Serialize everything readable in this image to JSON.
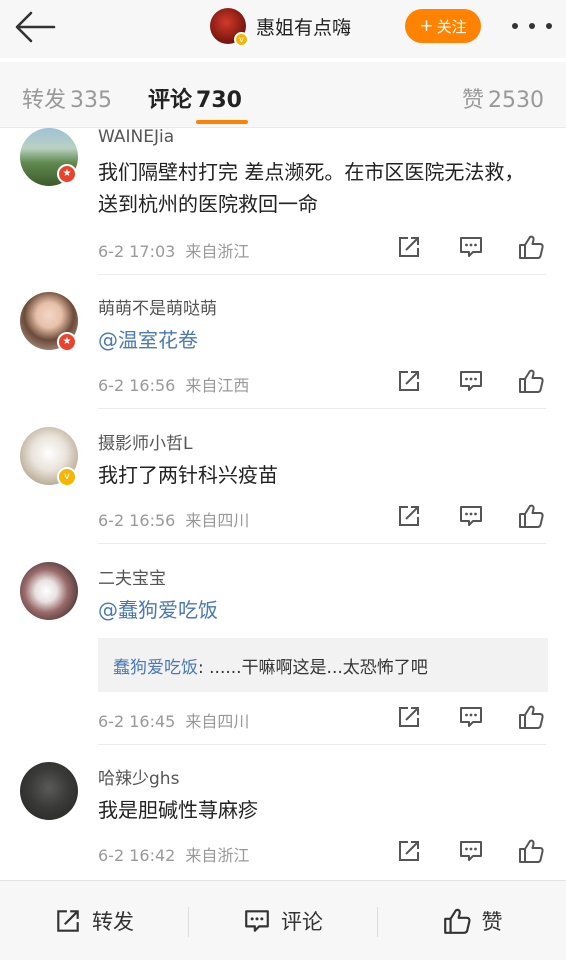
{
  "header": {
    "author_name": "惠姐有点嗨",
    "follow_label": "关注"
  },
  "tabs": {
    "repost": {
      "label": "转发",
      "count": "335"
    },
    "comment": {
      "label": "评论",
      "count": "730"
    },
    "like": {
      "label": "赞",
      "count": "2530"
    }
  },
  "comments": [
    {
      "user": "WAINEJia",
      "text": "我们隔壁村打完 差点濒死。在市区医院无法救，送到杭州的医院救回一命",
      "time": "6-2 17:03",
      "source": "来自浙江",
      "badge": "red"
    },
    {
      "user": "萌萌不是萌哒萌",
      "text": "@温室花卷",
      "time": "6-2 16:56",
      "source": "来自江西",
      "badge": "red"
    },
    {
      "user": "摄影师小哲L",
      "text": "我打了两针科兴疫苗",
      "time": "6-2 16:56",
      "source": "来自四川",
      "badge": "gold"
    },
    {
      "user": "二夫宝宝",
      "text": "@蠢狗爱吃饭",
      "time": "6-2 16:45",
      "source": "来自四川",
      "reply": {
        "name": "蠢狗爱吃饭",
        "text": ": ......干嘛啊这是...太恐怖了吧"
      }
    },
    {
      "user": "哈辣少ghs",
      "text": "我是胆碱性荨麻疹",
      "time": "6-2 16:42",
      "source": "来自浙江"
    }
  ],
  "bottom_bar": {
    "repost_label": "转发",
    "comment_label": "评论",
    "like_label": "赞"
  },
  "colors": {
    "accent": "#ff8200",
    "mention": "#4a79b4",
    "verified_red": "#e8432d",
    "verified_gold": "#f5b500"
  }
}
